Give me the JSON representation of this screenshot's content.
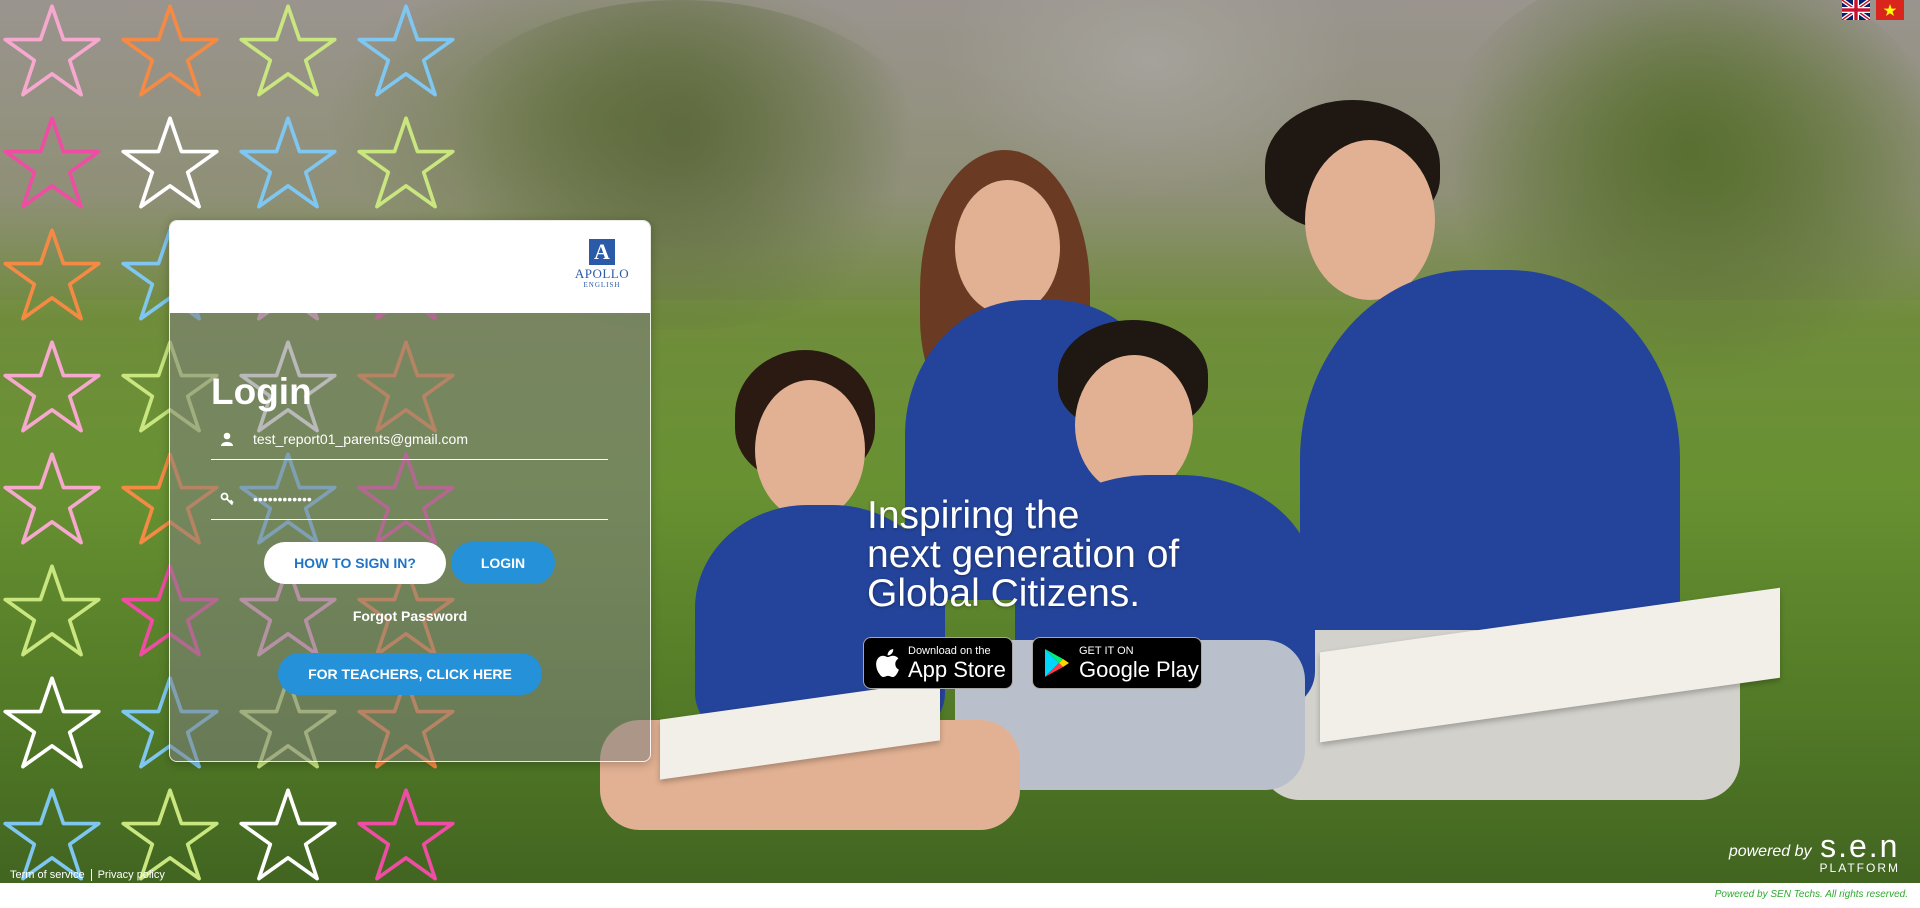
{
  "languages": [
    {
      "code": "en",
      "name": "English",
      "icon": "uk-flag-icon"
    },
    {
      "code": "vi",
      "name": "Tiếng Việt",
      "icon": "vietnam-flag-icon"
    }
  ],
  "brand": {
    "logo_mark": "A",
    "logo_name": "APOLLO",
    "logo_sub": "ENGLISH"
  },
  "login": {
    "title": "Login",
    "username_value": "test_report01_parents@gmail.com",
    "password_value": "••••••••••••",
    "how_to_label": "HOW TO SIGN IN?",
    "login_label": "LOGIN",
    "forgot_label": "Forgot Password",
    "teachers_label": "FOR TEACHERS, CLICK HERE"
  },
  "tagline": {
    "line1": "Inspiring the",
    "line2": "next generation of",
    "line3": "Global Citizens."
  },
  "stores": {
    "apple_small": "Download on the",
    "apple_big": "App Store",
    "google_small": "GET IT ON",
    "google_big": "Google Play"
  },
  "footer": {
    "terms": "Term of service",
    "privacy": "Privacy policy",
    "powered_by": "powered by",
    "platform_word": "s.e.n",
    "platform_sub": "PLATFORM",
    "copyright": "Powered by SEN Techs. All rights reserved."
  },
  "colors": {
    "accent_blue": "#2591d8",
    "how_to_text": "#1f74c6",
    "copyright_green": "#2eab2e",
    "star_colors": [
      "#f7a8cf",
      "#f58a45",
      "#c9e67f",
      "#7fc6f0",
      "#ef4da3",
      "#ffffff"
    ]
  }
}
